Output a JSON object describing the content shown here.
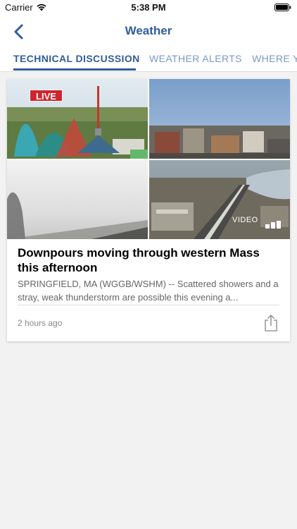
{
  "status_bar": {
    "carrier": "Carrier",
    "time": "5:38 PM",
    "icons": [
      "wifi-icon",
      "battery-icon"
    ]
  },
  "nav": {
    "title": "Weather",
    "back_icon": "chevron-left-icon"
  },
  "tabs": [
    {
      "label": "TECHNICAL DISCUSSION",
      "active": true
    },
    {
      "label": "WEATHER ALERTS",
      "active": false
    },
    {
      "label": "WHERE YOU LIVE",
      "active": false
    }
  ],
  "article": {
    "live_badge": "LIVE",
    "video_label": "VIDEO",
    "headline": "Downpours moving through western Mass this afternoon",
    "summary": "SPRINGFIELD, MA (WGGB/WSHM) -- Scattered showers and a stray, weak thunderstorm are possible this evening a...",
    "timestamp": "2 hours ago",
    "share_icon": "share-icon"
  },
  "colors": {
    "accent": "#2f5d9e",
    "inactive_tab": "#7c98c7",
    "live_red": "#d0242e",
    "background": "#f2f2f2"
  }
}
